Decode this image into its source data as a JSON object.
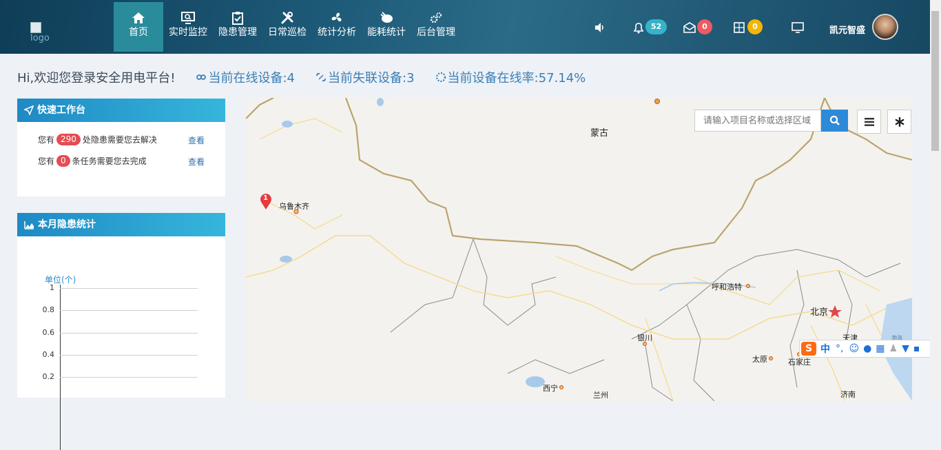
{
  "header": {
    "logo_alt": "logo",
    "nav": [
      {
        "label": "首页",
        "icon": "home-icon",
        "active": true
      },
      {
        "label": "实时监控",
        "icon": "monitor-search-icon",
        "active": false
      },
      {
        "label": "隐患管理",
        "icon": "clipboard-icon",
        "active": false
      },
      {
        "label": "日常巡检",
        "icon": "tools-icon",
        "active": false
      },
      {
        "label": "统计分析",
        "icon": "fan-icon",
        "active": false
      },
      {
        "label": "能耗统计",
        "icon": "plug-icon",
        "active": false
      },
      {
        "label": "后台管理",
        "icon": "gears-icon",
        "active": false
      }
    ],
    "badges": {
      "alarm": "52",
      "mail": "0",
      "calc": "0"
    },
    "badge_colors": {
      "alarm": "#34b3c9",
      "mail": "#ee5b62",
      "calc": "#f2b705"
    },
    "username": "凯元智盛"
  },
  "stats": {
    "welcome": "Hi,欢迎您登录安全用电平台!",
    "online": "当前在线设备:4",
    "offline": "当前失联设备:3",
    "rate": "当前设备在线率:57.14%"
  },
  "quick": {
    "title": "快速工作台",
    "rows": [
      {
        "prefix": "您有",
        "count": "290",
        "suffix": "处隐患需要您去解决",
        "link": "查看"
      },
      {
        "prefix": "您有",
        "count": "0",
        "suffix": "条任务需要您去完成",
        "link": "查看"
      }
    ]
  },
  "hazard": {
    "title": "本月隐患统计",
    "unit": "单位(个)",
    "yticks": [
      "1",
      "0.8",
      "0.6",
      "0.4",
      "0.2"
    ]
  },
  "map": {
    "search_placeholder": "请输入项目名称或选择区域",
    "marker_count": "1",
    "places": {
      "mongolia": "蒙古",
      "urumqi": "乌鲁木齐",
      "hohhot": "呼和浩特",
      "beijing": "北京",
      "tianjin": "天津",
      "yinchuan": "银川",
      "taiyuan": "太原",
      "shijiazhuang": "石家庄",
      "xining": "西宁",
      "lanzhou": "兰州",
      "jinan": "济南",
      "bohai": "渤海"
    }
  },
  "ime": {
    "lang": "中"
  }
}
